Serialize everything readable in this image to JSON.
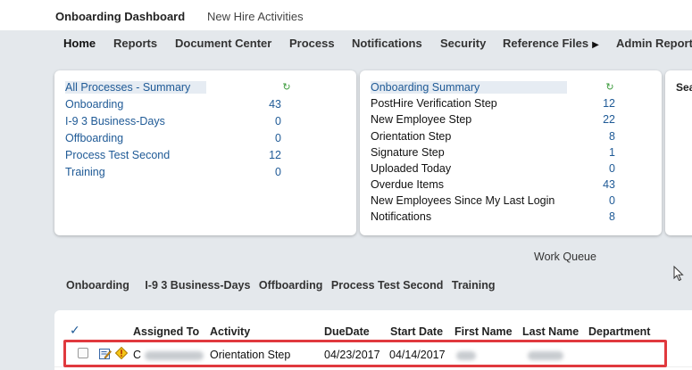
{
  "topbar": {
    "title": "Onboarding Dashboard",
    "subtitle": "New Hire Activities"
  },
  "nav": {
    "items": [
      "Home",
      "Reports",
      "Document Center",
      "Process",
      "Notifications",
      "Security",
      "Reference Files",
      "Admin Report"
    ]
  },
  "panel1": {
    "header": "All Processes - Summary",
    "rows": [
      {
        "label": "Onboarding",
        "value": "43"
      },
      {
        "label": "I-9 3 Business-Days",
        "value": "0"
      },
      {
        "label": "Offboarding",
        "value": "0"
      },
      {
        "label": "Process Test Second",
        "value": "12"
      },
      {
        "label": "Training",
        "value": "0"
      }
    ]
  },
  "panel2": {
    "header": "Onboarding Summary",
    "rows": [
      {
        "label": "PostHire Verification Step",
        "value": "12"
      },
      {
        "label": "New Employee Step",
        "value": "22"
      },
      {
        "label": "Orientation Step",
        "value": "8"
      },
      {
        "label": "Signature Step",
        "value": "1"
      },
      {
        "label": "Uploaded Today",
        "value": "0"
      },
      {
        "label": "Overdue Items",
        "value": "43"
      },
      {
        "label": "New Employees Since My Last Login",
        "value": "0"
      },
      {
        "label": "Notifications",
        "value": "8"
      }
    ]
  },
  "panel3": {
    "header": "Sea"
  },
  "work_queue": {
    "label": "Work Queue"
  },
  "queue_tabs": [
    "Onboarding",
    "I-9 3 Business-Days",
    "Offboarding",
    "Process Test Second",
    "Training"
  ],
  "grid": {
    "check_mark": "✓",
    "columns": [
      "Assigned To",
      "Activity",
      "DueDate",
      "Start Date",
      "First Name",
      "Last Name",
      "Department"
    ],
    "row": {
      "assigned_prefix": "C",
      "activity": "Orientation Step",
      "due_date": "04/23/2017",
      "start_date": "04/14/2017"
    }
  },
  "colors": {
    "link": "#1f5a96",
    "highlight": "#e0393e",
    "refresh": "#3a9a3a"
  },
  "icons": [
    "refresh-icon",
    "edit-icon",
    "warning-icon",
    "chevron-right-icon",
    "mouse-cursor-icon"
  ]
}
